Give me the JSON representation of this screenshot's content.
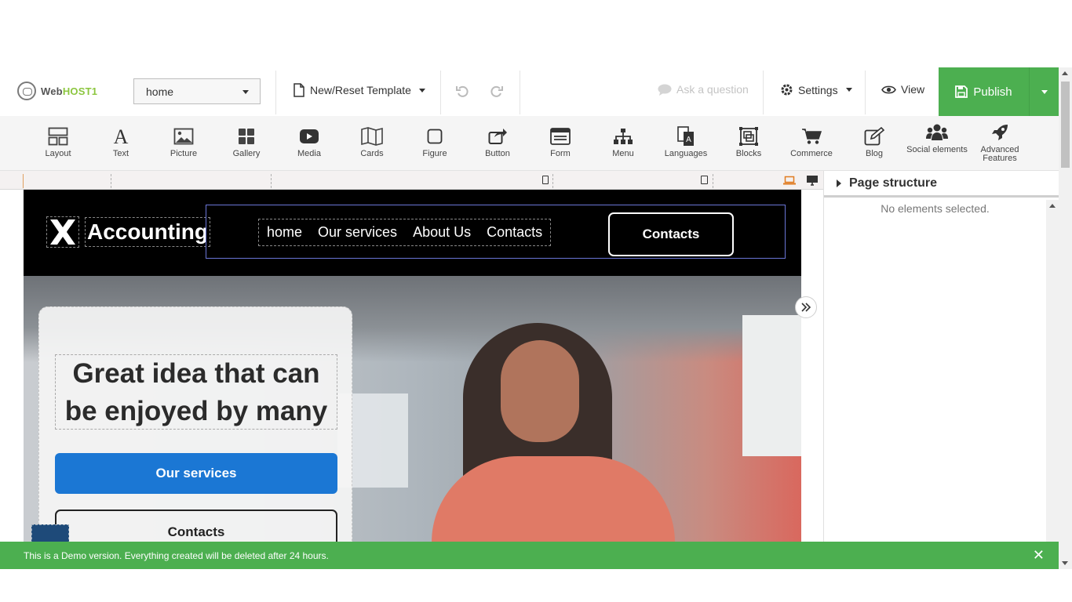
{
  "topbar": {
    "logo_prefix": "Web",
    "logo_suffix": "HOST1",
    "page_select": "home",
    "template": "New/Reset Template",
    "ask": "Ask a question",
    "settings": "Settings",
    "view": "View",
    "publish": "Publish"
  },
  "palette": [
    {
      "label": "Layout",
      "icon": "layout-icon"
    },
    {
      "label": "Text",
      "icon": "text-icon"
    },
    {
      "label": "Picture",
      "icon": "picture-icon"
    },
    {
      "label": "Gallery",
      "icon": "gallery-icon"
    },
    {
      "label": "Media",
      "icon": "media-icon"
    },
    {
      "label": "Cards",
      "icon": "cards-icon"
    },
    {
      "label": "Figure",
      "icon": "figure-icon"
    },
    {
      "label": "Button",
      "icon": "button-icon"
    },
    {
      "label": "Form",
      "icon": "form-icon"
    },
    {
      "label": "Menu",
      "icon": "menu-icon"
    },
    {
      "label": "Languages",
      "icon": "languages-icon"
    },
    {
      "label": "Blocks",
      "icon": "blocks-icon"
    },
    {
      "label": "Commerce",
      "icon": "commerce-icon"
    },
    {
      "label": "Blog",
      "icon": "blog-icon"
    },
    {
      "label": "Social elements",
      "icon": "social-icon"
    },
    {
      "label": "Advanced Features",
      "icon": "rocket-icon"
    }
  ],
  "site": {
    "brand": "Accounting",
    "nav": [
      "home",
      "Our services",
      "About Us",
      "Contacts"
    ],
    "nav_button": "Contacts",
    "hero_title": "Great idea that can be enjoyed by many",
    "hero_button": "Our services",
    "hero_button2": "Contacts"
  },
  "panel": {
    "title": "Page structure",
    "empty": "No elements selected."
  },
  "banner": {
    "text": "This is a Demo version. Everything created will be deleted after 24 hours."
  },
  "colors": {
    "publish": "#4caf50",
    "primary_button": "#1b77d4",
    "banner": "#4caf50"
  }
}
